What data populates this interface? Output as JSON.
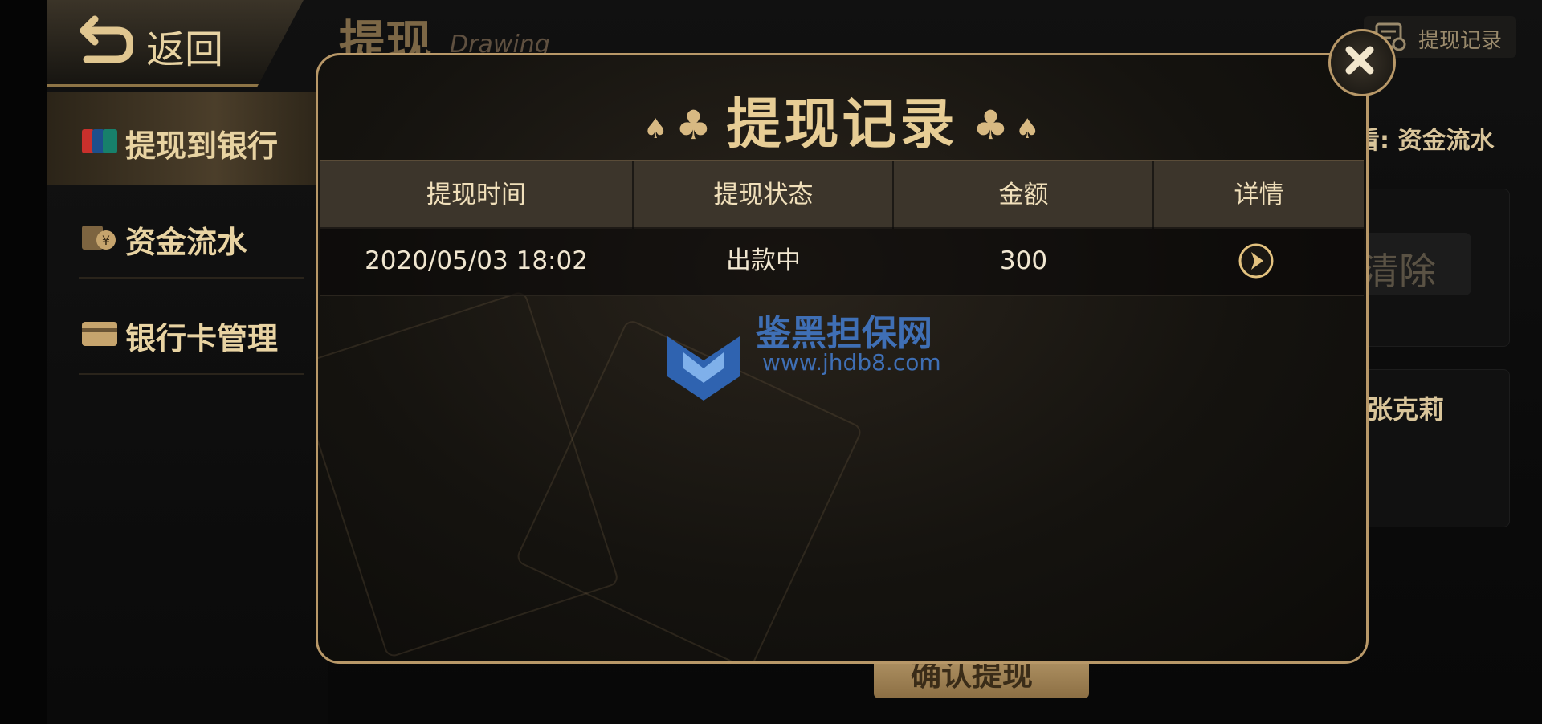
{
  "topbar": {
    "back_label": "返回",
    "page_title": "提现",
    "page_subtitle": "Drawing",
    "record_button_label": "提现记录"
  },
  "sidebar": {
    "items": [
      {
        "label": "提现到银行",
        "icon": "unionpay-icon",
        "active": true
      },
      {
        "label": "资金流水",
        "icon": "money-icon",
        "active": false
      },
      {
        "label": "银行卡管理",
        "icon": "bank-card-icon",
        "active": false
      }
    ]
  },
  "background": {
    "view_flow_text": "看: 资金流水",
    "clear_button": "清除",
    "name_text": ": 张克莉",
    "confirm_button": "确认提现"
  },
  "modal": {
    "title": "提现记录",
    "columns": [
      "提现时间",
      "提现状态",
      "金额",
      "详情"
    ],
    "rows": [
      {
        "time": "2020/05/03 18:02",
        "status": "出款中",
        "amount": "300"
      }
    ],
    "watermark_title": "鉴黑担保网",
    "watermark_url": "www.jhdb8.com"
  },
  "colors": {
    "gold": "#e7cd95",
    "border": "#b89868",
    "watermark": "#3f6fb5"
  }
}
